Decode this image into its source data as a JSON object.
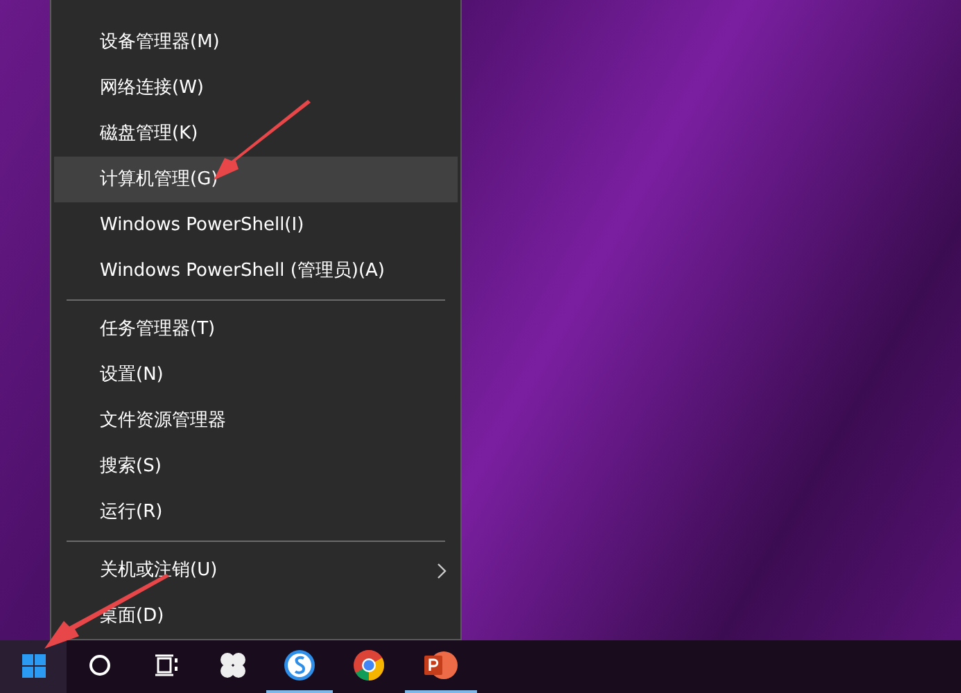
{
  "menu": {
    "groups": [
      {
        "items": [
          {
            "label": "设备管理器(M)",
            "selected": false,
            "submenu": false
          },
          {
            "label": "网络连接(W)",
            "selected": false,
            "submenu": false
          },
          {
            "label": "磁盘管理(K)",
            "selected": false,
            "submenu": false
          },
          {
            "label": "计算机管理(G)",
            "selected": true,
            "submenu": false
          },
          {
            "label": "Windows PowerShell(I)",
            "selected": false,
            "submenu": false
          },
          {
            "label": "Windows PowerShell (管理员)(A)",
            "selected": false,
            "submenu": false
          }
        ]
      },
      {
        "items": [
          {
            "label": "任务管理器(T)",
            "selected": false,
            "submenu": false
          },
          {
            "label": "设置(N)",
            "selected": false,
            "submenu": false
          },
          {
            "label": "文件资源管理器",
            "selected": false,
            "submenu": false
          },
          {
            "label": "搜索(S)",
            "selected": false,
            "submenu": false
          },
          {
            "label": "运行(R)",
            "selected": false,
            "submenu": false
          }
        ]
      },
      {
        "items": [
          {
            "label": "关机或注销(U)",
            "selected": false,
            "submenu": true
          },
          {
            "label": "桌面(D)",
            "selected": false,
            "submenu": false
          }
        ]
      }
    ]
  },
  "taskbar": {
    "items": [
      {
        "kind": "start",
        "running": false
      },
      {
        "kind": "search",
        "running": false
      },
      {
        "kind": "taskview",
        "running": false
      },
      {
        "kind": "pinwheel",
        "running": false
      },
      {
        "kind": "browser-s",
        "running": true
      },
      {
        "kind": "chrome",
        "running": false
      },
      {
        "kind": "slides",
        "running": true
      }
    ]
  }
}
